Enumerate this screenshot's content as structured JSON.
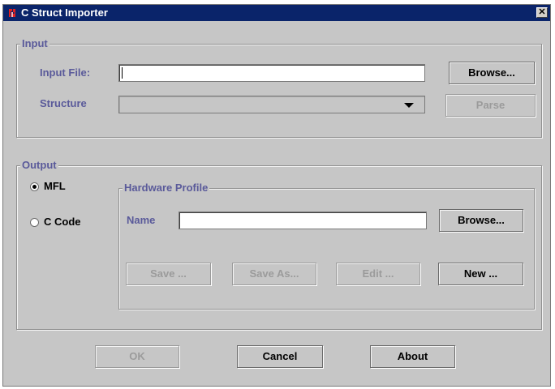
{
  "window": {
    "title": "C Struct Importer",
    "close_symbol": "✕",
    "accent": "#0a246a",
    "label_color": "#5a5a9a"
  },
  "input_group": {
    "legend": "Input",
    "input_file_label": "Input File:",
    "input_file_value": "",
    "structure_label": "Structure",
    "structure_value": "",
    "browse_label": "Browse...",
    "parse_label": "Parse"
  },
  "output_group": {
    "legend": "Output",
    "format_options": [
      {
        "label": "MFL",
        "checked": true
      },
      {
        "label": "C Code",
        "checked": false
      }
    ],
    "hardware_profile": {
      "legend": "Hardware Profile",
      "name_label": "Name",
      "name_value": "",
      "browse_label": "Browse...",
      "save_label": "Save ...",
      "save_as_label": "Save As...",
      "edit_label": "Edit ...",
      "new_label": "New ..."
    }
  },
  "footer": {
    "ok_label": "OK",
    "cancel_label": "Cancel",
    "about_label": "About"
  }
}
